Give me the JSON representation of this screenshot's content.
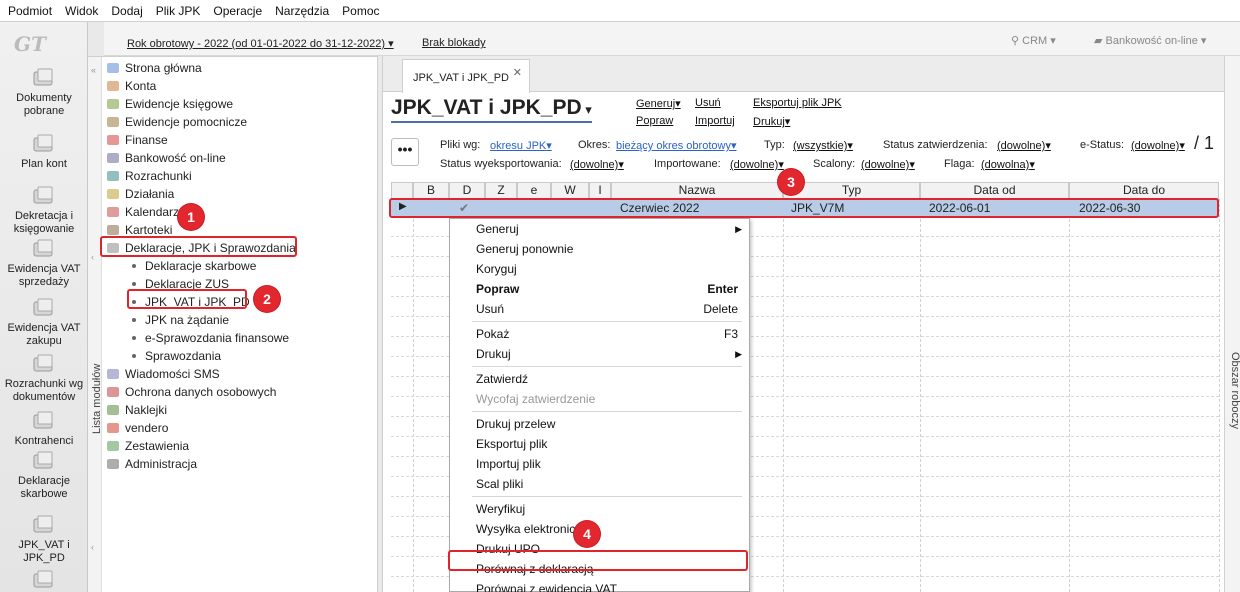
{
  "menubar": [
    "Podmiot",
    "Widok",
    "Dodaj",
    "Plik JPK",
    "Operacje",
    "Narzędzia",
    "Pomoc"
  ],
  "topbar": {
    "rok": "Rok obrotowy - 2022  (od 01-01-2022 do 31-12-2022)",
    "brak": "Brak blokady",
    "crm": "CRM",
    "bank": "Bankowość on-line"
  },
  "iconbar": {
    "logo": "GT",
    "items": [
      {
        "label": "Dokumenty\npobrane",
        "icon": "documents-download-icon"
      },
      {
        "label": "Plan kont",
        "icon": "chart-of-accounts-icon"
      },
      {
        "label": "Dekretacja i\nksięgowanie",
        "icon": "posting-icon"
      },
      {
        "label": "Ewidencja VAT\nsprzedaży",
        "icon": "vat-sales-icon"
      },
      {
        "label": "Ewidencja VAT\nzakupu",
        "icon": "vat-purchase-icon"
      },
      {
        "label": "Rozrachunki wg\ndokumentów",
        "icon": "settlements-icon"
      },
      {
        "label": "Kontrahenci",
        "icon": "contractors-icon"
      },
      {
        "label": "Deklaracje\nskarbowe",
        "icon": "tax-declarations-icon"
      },
      {
        "label": "JPK_VAT i\nJPK_PD",
        "icon": "jpk-icon"
      },
      {
        "label": "",
        "icon": "more-icon"
      }
    ]
  },
  "modpanel": {
    "strip_label": "Lista modułów",
    "items": [
      {
        "label": "Strona główna",
        "icon": "home-icon"
      },
      {
        "label": "Konta",
        "icon": "accounts-icon"
      },
      {
        "label": "Ewidencje księgowe",
        "icon": "ledger-icon"
      },
      {
        "label": "Ewidencje pomocnicze",
        "icon": "aux-ledger-icon"
      },
      {
        "label": "Finanse",
        "icon": "finance-icon"
      },
      {
        "label": "Bankowość on-line",
        "icon": "bank-icon"
      },
      {
        "label": "Rozrachunki",
        "icon": "settlements-icon"
      },
      {
        "label": "Działania",
        "icon": "actions-icon"
      },
      {
        "label": "Kalendarz",
        "icon": "calendar-icon"
      },
      {
        "label": "Kartoteki",
        "icon": "files-icon"
      },
      {
        "label": "Deklaracje, JPK i Sprawozdania",
        "icon": "declarations-icon"
      }
    ],
    "subitems": [
      "Deklaracje skarbowe",
      "Deklaracje ZUS",
      "JPK_VAT i JPK_PD",
      "JPK na żądanie",
      "e-Sprawozdania finansowe",
      "Sprawozdania"
    ],
    "items2": [
      {
        "label": "Wiadomości SMS",
        "icon": "sms-icon"
      },
      {
        "label": "Ochrona danych osobowych",
        "icon": "privacy-icon"
      },
      {
        "label": "Naklejki",
        "icon": "stickers-icon"
      },
      {
        "label": "vendero",
        "icon": "vendero-icon"
      },
      {
        "label": "Zestawienia",
        "icon": "reports-icon"
      },
      {
        "label": "Administracja",
        "icon": "admin-icon"
      }
    ]
  },
  "content": {
    "tab": "JPK_VAT i JPK_PD",
    "title": "JPK_VAT i JPK_PD",
    "toolbar": {
      "generuj": "Generuj",
      "usun": "Usuń",
      "eksportuj": "Eksportuj plik JPK",
      "popraw": "Popraw",
      "importuj": "Importuj",
      "drukuj": "Drukuj"
    },
    "filters": {
      "pliki_label": "Pliki wg:",
      "pliki_val": "okresu JPK",
      "okres_label": "Okres:",
      "okres_val": "bieżący okres obrotowy",
      "typ_label": "Typ:",
      "typ_val": "(wszystkie)",
      "status_zatw_label": "Status zatwierdzenia:",
      "status_zatw_val": "(dowolne)",
      "estatus_label": "e-Status:",
      "estatus_val": "(dowolne)",
      "page": "/ 1",
      "status_eksp_label": "Status wyeksportowania:",
      "status_eksp_val": "(dowolne)",
      "importowane_label": "Importowane:",
      "importowane_val": "(dowolne)",
      "scalony_label": "Scalony:",
      "scalony_val": "(dowolne)",
      "flaga_label": "Flaga:",
      "flaga_val": "(dowolna)"
    },
    "columns": [
      "B",
      "D",
      "Z",
      "e",
      "W",
      "I",
      "Nazwa",
      "Typ",
      "Data od",
      "Data do"
    ],
    "row": {
      "nazwa": "Czerwiec 2022",
      "typ": "JPK_V7M",
      "data_od": "2022-06-01",
      "data_do": "2022-06-30",
      "d_check": "✔"
    }
  },
  "context_menu": [
    {
      "label": "Generuj",
      "submenu": true
    },
    {
      "label": "Generuj ponownie"
    },
    {
      "label": "Koryguj"
    },
    {
      "label": "Popraw",
      "shortcut": "Enter",
      "bold": true
    },
    {
      "label": "Usuń",
      "shortcut": "Delete"
    },
    {
      "sep": true
    },
    {
      "label": "Pokaż",
      "shortcut": "F3"
    },
    {
      "label": "Drukuj",
      "submenu": true
    },
    {
      "sep": true
    },
    {
      "label": "Zatwierdź"
    },
    {
      "label": "Wycofaj zatwierdzenie",
      "disabled": true
    },
    {
      "sep": true
    },
    {
      "label": "Drukuj przelew"
    },
    {
      "label": "Eksportuj plik"
    },
    {
      "label": "Importuj plik"
    },
    {
      "label": "Scal pliki"
    },
    {
      "sep": true
    },
    {
      "label": "Weryfikuj"
    },
    {
      "label": "Wysyłka elektroniczna"
    },
    {
      "label": "Drukuj UPO"
    },
    {
      "label": "Porównaj z deklaracją"
    },
    {
      "label": "Porównaj z ewidencją VAT"
    }
  ],
  "right_strip_label": "Obszar roboczy",
  "badges": [
    "1",
    "2",
    "3",
    "4"
  ]
}
